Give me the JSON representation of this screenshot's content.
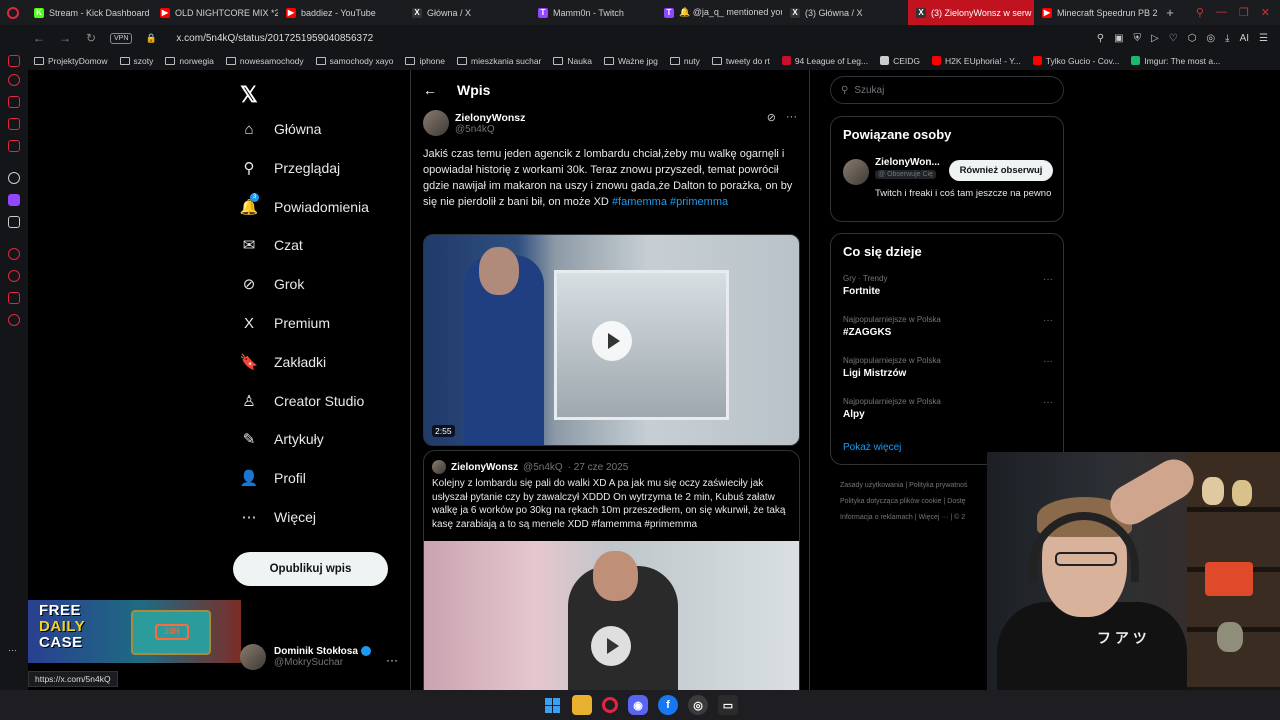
{
  "browser": {
    "tabs": [
      {
        "label": "Stream - Kick Dashboard",
        "color": "#53fc18",
        "glyph": "K"
      },
      {
        "label": "OLD NIGHTCORE MIX *2",
        "color": "#ff0000",
        "glyph": "▶"
      },
      {
        "label": "baddiez - YouTube",
        "color": "#ff0000",
        "glyph": "▶"
      },
      {
        "label": "Główna / X",
        "color": "#333333",
        "glyph": "X"
      },
      {
        "label": "Mamm0n - Twitch",
        "color": "#9146ff",
        "glyph": "T"
      },
      {
        "label": "🔔 @ja_q_ mentioned you",
        "color": "#9146ff",
        "glyph": "T"
      },
      {
        "label": "(3) Główna / X",
        "color": "#333333",
        "glyph": "X"
      },
      {
        "label": "(3) ZielonyWonsz w serw",
        "color": "#333333",
        "glyph": "X",
        "active": true
      },
      {
        "label": "Minecraft Speedrun PB 2",
        "color": "#ff0000",
        "glyph": "▶"
      }
    ],
    "url": "x.com/5n4kQ/status/2017251959040856372",
    "vpn_label": "VPN",
    "ai_label": "AI",
    "bookmarks": [
      {
        "label": "ProjektyDomow",
        "type": "folder"
      },
      {
        "label": "szoty",
        "type": "folder"
      },
      {
        "label": "norwegia",
        "type": "folder"
      },
      {
        "label": "nowesamochody",
        "type": "folder"
      },
      {
        "label": "samochody xayo",
        "type": "folder"
      },
      {
        "label": "iphone",
        "type": "folder"
      },
      {
        "label": "mieszkania suchar",
        "type": "folder"
      },
      {
        "label": "Nauka",
        "type": "folder"
      },
      {
        "label": "Ważne jpg",
        "type": "folder"
      },
      {
        "label": "nuty",
        "type": "folder"
      },
      {
        "label": "tweety do rt",
        "type": "folder"
      },
      {
        "label": "94 League of Leg...",
        "type": "site",
        "color": "#c8102e"
      },
      {
        "label": "CEIDG",
        "type": "site",
        "color": "#cccccc"
      },
      {
        "label": "H2K EUphoria! - Y...",
        "type": "site",
        "color": "#ff0000"
      },
      {
        "label": "Tylko Gucio - Cov...",
        "type": "site",
        "color": "#ff0000"
      },
      {
        "label": "Imgur: The most a...",
        "type": "site",
        "color": "#1bb76e"
      }
    ],
    "status_url": "https://x.com/5n4kQ"
  },
  "nav": {
    "items": [
      {
        "label": "Główna",
        "icon": "home-icon",
        "glyph": "⌂"
      },
      {
        "label": "Przeglądaj",
        "icon": "search-icon",
        "glyph": "⚲"
      },
      {
        "label": "Powiadomienia",
        "icon": "bell-icon",
        "glyph": "🔔",
        "badge": "3"
      },
      {
        "label": "Czat",
        "icon": "mail-icon",
        "glyph": "✉"
      },
      {
        "label": "Grok",
        "icon": "grok-icon",
        "glyph": "⊘"
      },
      {
        "label": "Premium",
        "icon": "x-premium-icon",
        "glyph": "X"
      },
      {
        "label": "Zakładki",
        "icon": "bookmark-icon",
        "glyph": "🔖"
      },
      {
        "label": "Creator Studio",
        "icon": "creator-icon",
        "glyph": "♙"
      },
      {
        "label": "Artykuły",
        "icon": "article-icon",
        "glyph": "✎"
      },
      {
        "label": "Profil",
        "icon": "profile-icon",
        "glyph": "👤"
      },
      {
        "label": "Więcej",
        "icon": "more-icon",
        "glyph": "⋯"
      }
    ],
    "post_button": "Opublikuj wpis",
    "account": {
      "name": "Dominik Stokłosa",
      "handle": "@MokrySuchar"
    }
  },
  "ad": {
    "line1": "FREE",
    "line2": "DAILY",
    "line3": "CASE",
    "box": "24H"
  },
  "post": {
    "header_title": "Wpis",
    "author_name": "ZielonyWonsz",
    "author_handle": "@5n4kQ",
    "text": "Jakiś czas temu jeden agencik z lombardu chciał,żeby mu walkę ogarnęli i opowiadał historię z workami 30k. Teraz znowu przyszedł, temat powrócił gdzie nawijał im makaron na uszy i znowu gada,że Dalton to porażka, on by się nie pierdolił z bani bił, on może XD",
    "tags": [
      "#famemma",
      "#primemma"
    ],
    "video_duration": "2:55",
    "quote": {
      "author_name": "ZielonyWonsz",
      "author_handle": "@5n4kQ",
      "date": "· 27 cze 2025",
      "text": "Kolejny z lombardu się pali do walki XD A pa jak mu się oczy zaświeciły jak usłyszał pytanie czy by zawalczył XDDD On wytrzyma te 2 min, Kubuś załatw walkę ja 6 worków po 30kg na rękach 10m przeszedłem, on się wkurwił, że taką kasę zarabiają a to są menele XDD #famemma #primemma"
    }
  },
  "right": {
    "search_placeholder": "Szukaj",
    "who_title": "Powiązane osoby",
    "who": {
      "name": "ZielonyWon...",
      "follows_you": "Obserwuje Cię",
      "button": "Również obserwuj",
      "bio": "Twitch i freaki i coś tam jeszcze na pewno",
      "handle_prefix": "@"
    },
    "trends_title": "Co się dzieje",
    "trends": [
      {
        "meta": "Gry · Trendy",
        "name": "Fortnite"
      },
      {
        "meta": "Najpopularniejsze w Polska",
        "name": "#ZAGGKS"
      },
      {
        "meta": "Najpopularniejsze w Polska",
        "name": "Ligi Mistrzów"
      },
      {
        "meta": "Najpopularniejsze w Polska",
        "name": "Alpy"
      }
    ],
    "show_more": "Pokaż więcej",
    "footer": [
      "Zasady użytkowania",
      "Polityka prywatnoś",
      "Polityka dotycząca plików cookie",
      "Dostę",
      "Informacja o reklamach",
      "Więcej ···",
      "© 2"
    ]
  },
  "webcam": {
    "shirt_text": "フ ア ツ"
  }
}
